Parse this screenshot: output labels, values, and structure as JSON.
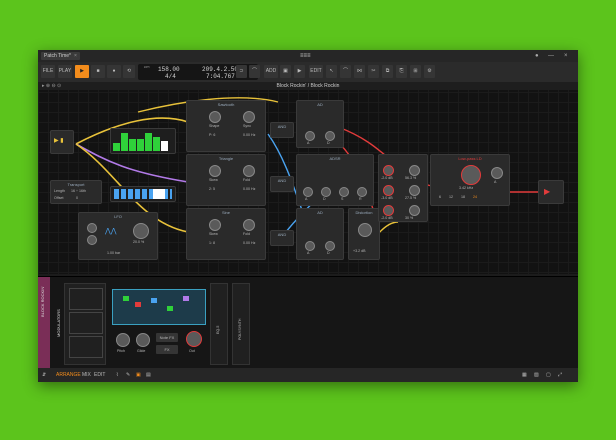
{
  "window": {
    "tab_title": "Patch Time*",
    "tab_close": "×"
  },
  "toolbar": {
    "file": "FILE",
    "play": "PLAY",
    "tempo": "158.00",
    "position": "209.4.2.50",
    "time_signature": "4/4",
    "time": "7:04.767",
    "add": "ADD",
    "edit": "EDIT"
  },
  "breadcrumb": "Block Rockin' / Block Rockin",
  "modules": {
    "sawtooth": {
      "title": "Sawtooth",
      "shape": "Shape",
      "sync": "Sync",
      "value1": "P: 6",
      "value2": "0.00 Hz"
    },
    "triangle": {
      "title": "Triangle",
      "skew": "Skew",
      "fold": "Fold",
      "value1": "2: 5",
      "value2": "0.00 Hz"
    },
    "sine": {
      "title": "Sine",
      "skew": "Skew",
      "fold": "Fold",
      "value1": "1: 8",
      "value2": "0.00 Hz"
    },
    "and1": "AND",
    "and2": "AND",
    "and3": "AND",
    "ad": "AD",
    "adsr": "ADSR",
    "ad2": "AD",
    "distortion": "Distortion",
    "lowpass": "Low-pass LD",
    "lfo": "LFO",
    "transport": {
      "title": "Transport",
      "length": "Length",
      "offset": "Offset",
      "length_val": "16 ÷ 16th",
      "offset_val": "0"
    },
    "env_letters": {
      "a": "A",
      "d": "D",
      "s": "S",
      "r": "R"
    },
    "vca_values": {
      "v1": "-2.0 dB",
      "v2": "-3.0 dB",
      "v3": "-2.0 dB",
      "p1": "56.3 %",
      "p2": "27.5 %",
      "p3": "30 %"
    },
    "lp_freq": "3.42 kHz",
    "lp_slopes": [
      "6",
      "12",
      "18",
      "24"
    ],
    "dist_gain": "+3.2 dB",
    "lfo_rate": "1.00 bar",
    "lfo_pct": "20.0 %"
  },
  "device_panel": {
    "track_name": "BLOCK ROCKIN'",
    "section_label": "MODULATORS",
    "knob_pitch": "Pitch",
    "knob_glide": "Glide",
    "knob_out": "Out",
    "note_fx": "Note FX",
    "fx": "FX",
    "side1": "EQ-5",
    "side2": "POLYSYNTH"
  },
  "status": {
    "arrange": "ARRANGE",
    "mix": "MIX",
    "edit": "EDIT"
  },
  "colors": {
    "background": "#5cc41c",
    "accent": "#f28c1c",
    "green_led": "#2fd13a",
    "red_cable": "#e23b3b",
    "yellow_cable": "#e8c23a",
    "blue_cable": "#4aa3f0",
    "purple_cable": "#b27ae8"
  }
}
